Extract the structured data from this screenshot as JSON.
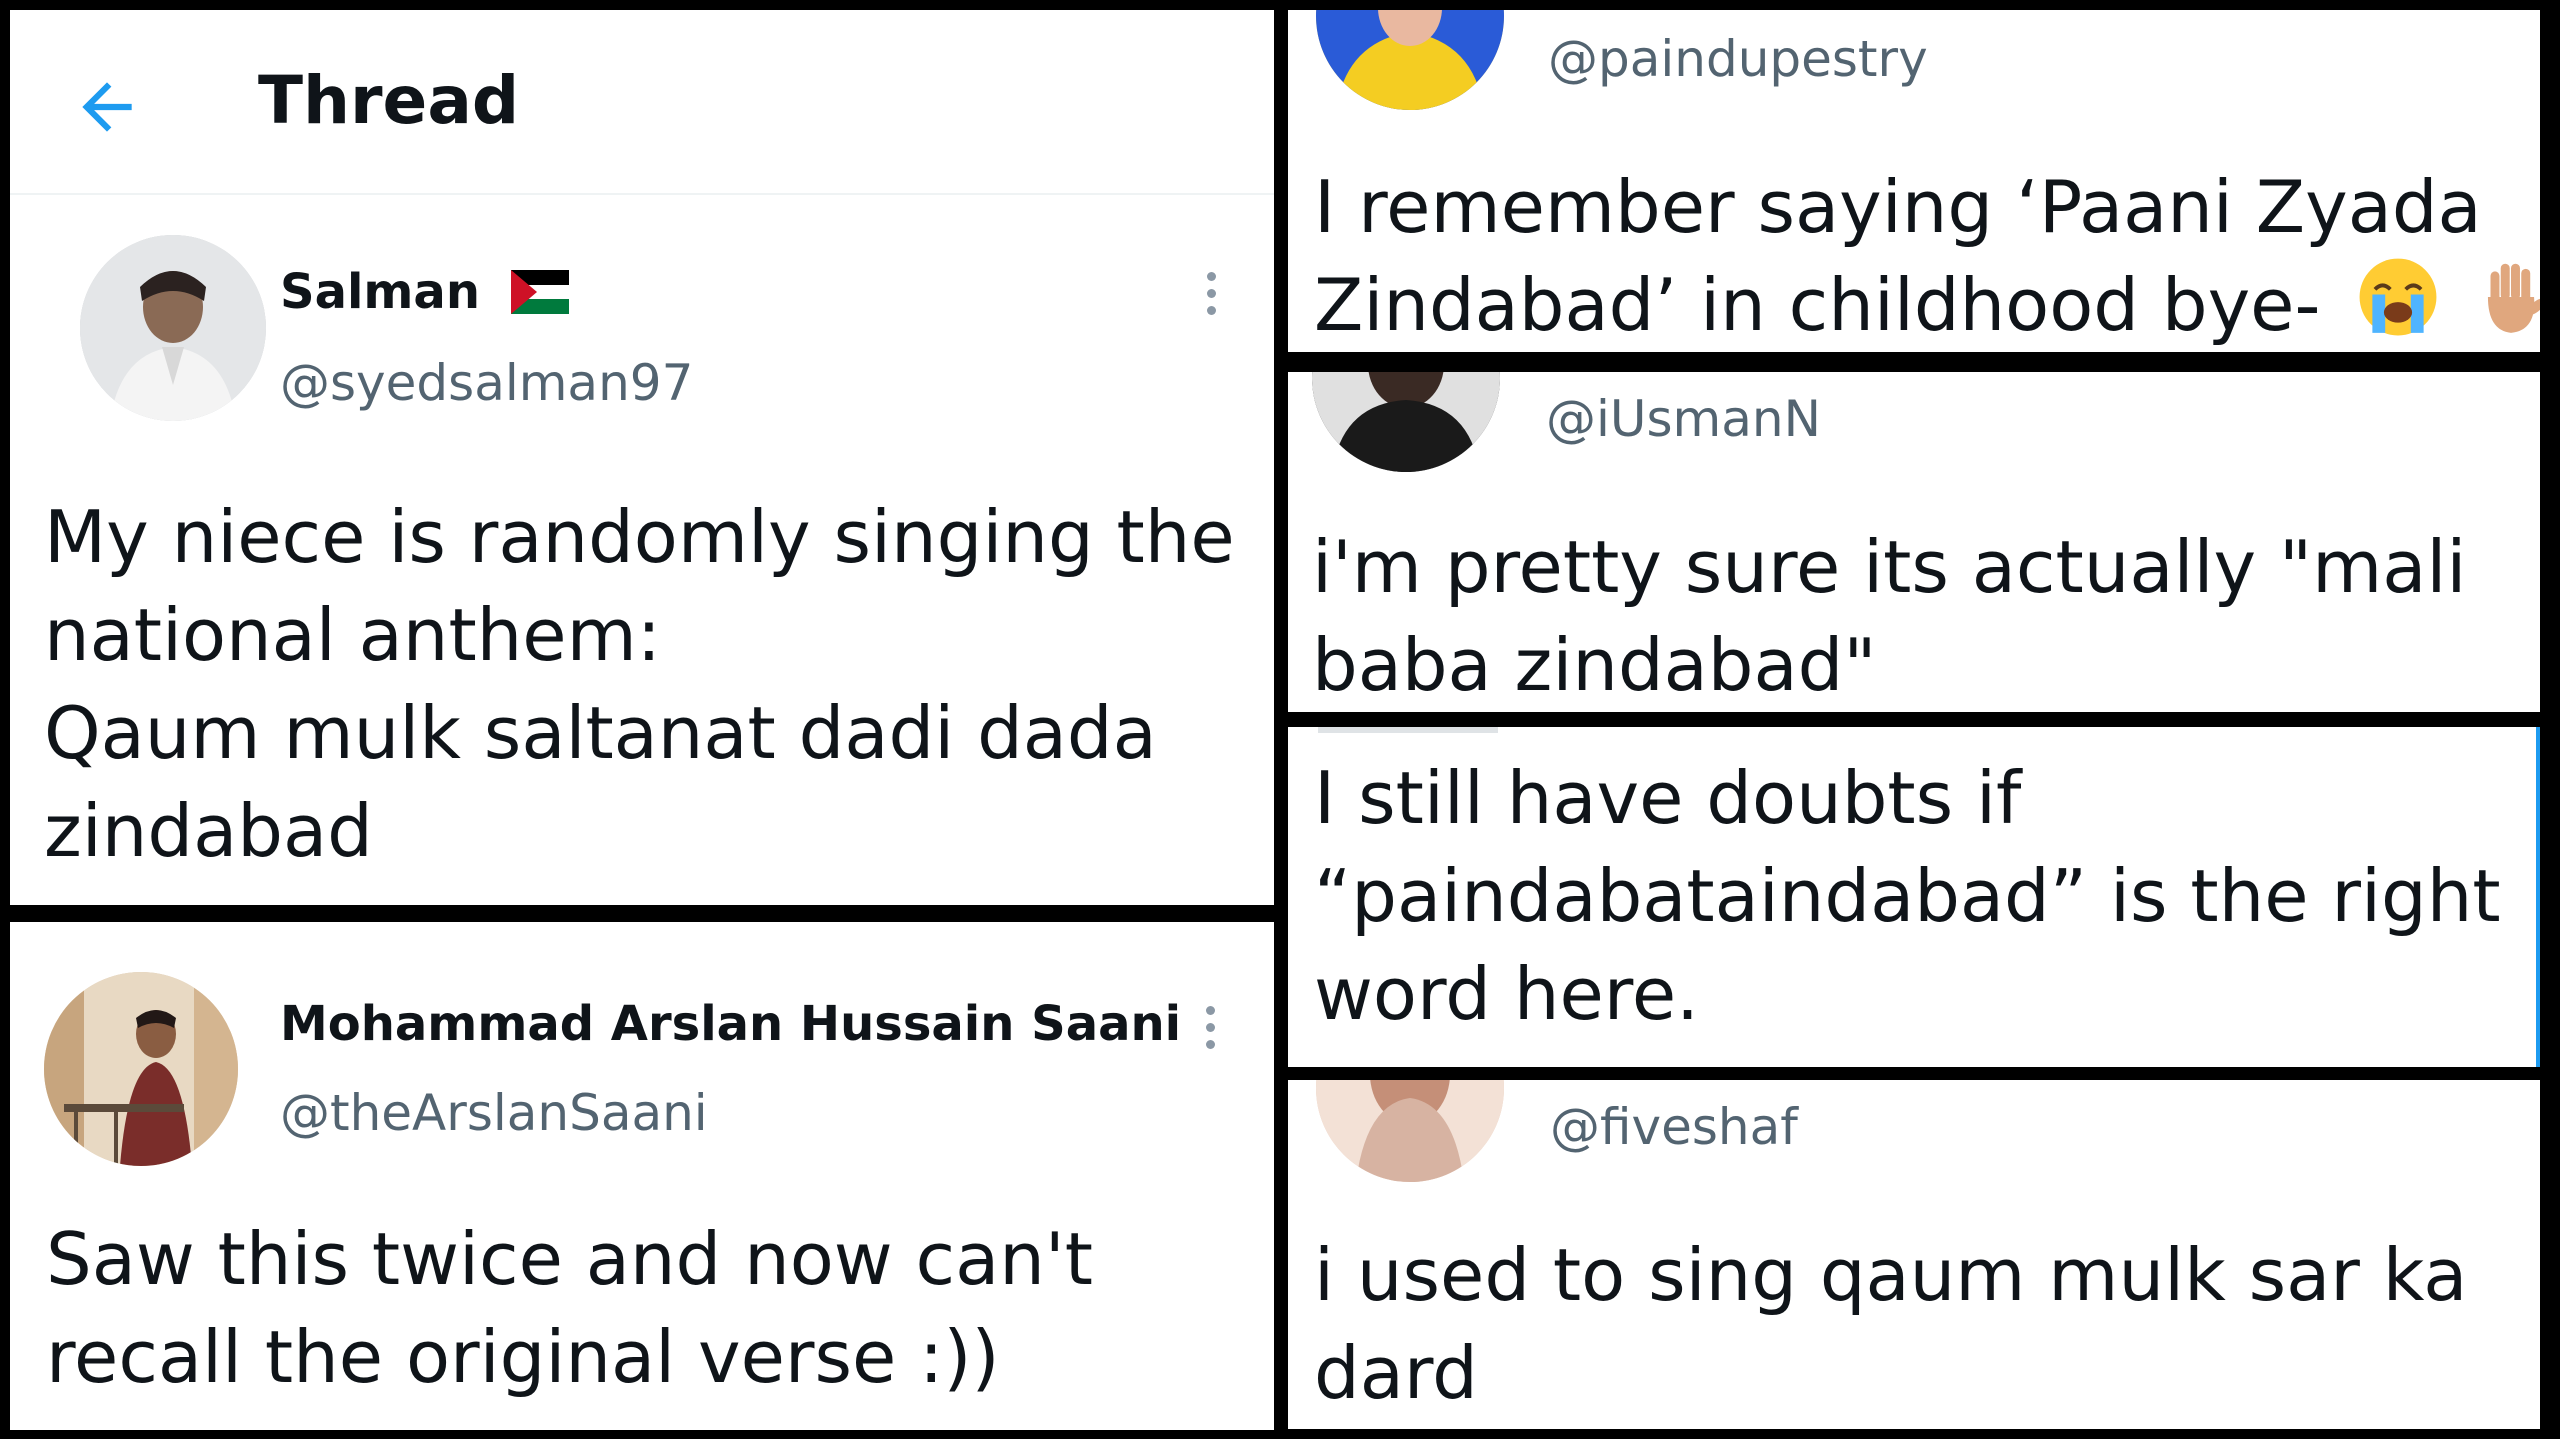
{
  "header": {
    "title": "Thread"
  },
  "tweets": [
    {
      "name": "Salman",
      "handle": "@syedsalman97",
      "lines": [
        "My niece is randomly singing the",
        "national anthem:",
        "Qaum mulk saltanat dadi dada",
        "zindabad"
      ],
      "flag_colors": [
        "#000000",
        "#ffffff",
        "#007a3d",
        "#ce1126"
      ]
    },
    {
      "name": "Mohammad Arslan Hussain Saani",
      "handle": "@theArslanSaani",
      "lines": [
        "Saw this twice and now can't",
        "recall the original verse :))"
      ]
    },
    {
      "handle": "@paindupestry",
      "lines": [
        "I remember saying ‘Paani Zyada",
        "Zindabad’ in childhood bye-"
      ]
    },
    {
      "handle": "@iUsmanN",
      "lines": [
        "i'm pretty sure its actually \"mali",
        "baba zindabad\""
      ]
    },
    {
      "lines": [
        "I still have doubts if",
        "“paindabataindabad” is the right",
        "word here."
      ]
    },
    {
      "handle": "@fiveshaf",
      "lines": [
        "i used to sing qaum mulk sar ka",
        "dard"
      ]
    }
  ],
  "icons": {
    "back": "arrow-left-icon",
    "more": "more-vertical-icon",
    "flag": "palestine-flag-icon",
    "crying": "loudly-crying-face-emoji",
    "hand": "raised-hand-emoji"
  },
  "colors": {
    "accent": "#1d9bf0",
    "secondary_text": "#536471",
    "primary_text": "#0f1419"
  }
}
